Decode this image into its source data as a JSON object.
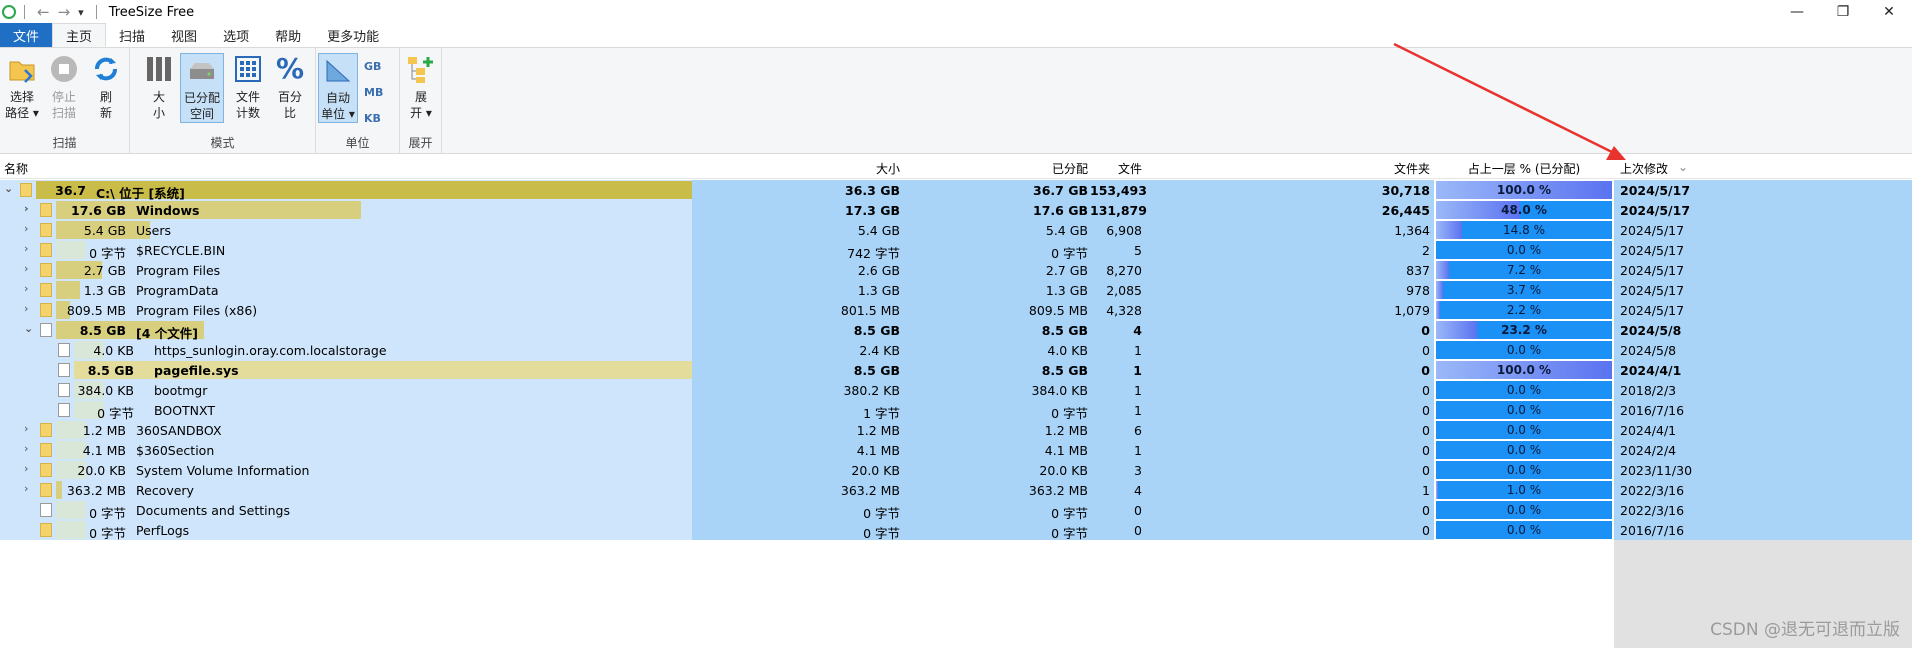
{
  "window": {
    "title": "TreeSize Free",
    "minimize": "—",
    "restore": "❐",
    "close": "✕",
    "back": "←",
    "forward": "→",
    "quick_access": "▾"
  },
  "tabs": [
    "文件",
    "主页",
    "扫描",
    "视图",
    "选项",
    "帮助",
    "更多功能"
  ],
  "ribbon": {
    "groups": {
      "scan": "扫描",
      "mode": "模式",
      "unit": "单位",
      "expand": "展开"
    },
    "buttons": {
      "select_path": "选择路径",
      "select_path_l1": "选择",
      "select_path_l2": "路径 ▾",
      "stop_l1": "停止",
      "stop_l2": "扫描",
      "refresh_l1": "刷",
      "refresh_l2": "新",
      "size_l1": "大",
      "size_l2": "小",
      "alloc_l1": "已分配",
      "alloc_l2": "空间",
      "count_l1": "文件",
      "count_l2": "计数",
      "pct_l1": "百分",
      "pct_l2": "比",
      "auto_l1": "自动",
      "auto_l2": "单位 ▾",
      "gb": "GB",
      "mb": "MB",
      "kb": "KB",
      "expand_l1": "展",
      "expand_l2": "开 ▾"
    }
  },
  "columns": {
    "name": "名称",
    "size": "大小",
    "allocated": "已分配",
    "files": "文件",
    "folders": "文件夹",
    "parent_pct": "占上一层 % (已分配)",
    "modified": "上次修改",
    "sort_indicator": "⌄"
  },
  "rows": [
    {
      "name": "C:\\  位于 [系统]",
      "size_label": "36.7 GB",
      "size": "36.3 GB",
      "allocated": "36.7 GB",
      "files": "153,493",
      "folders": "30,718",
      "pct": "100.0 %",
      "pct_value": 1.0,
      "bar_fraction": 1.0,
      "date": "2024/5/17",
      "bold": true,
      "level": 0,
      "icon": "folder",
      "expander": "⌄"
    },
    {
      "name": "Windows",
      "size_label": "17.6 GB",
      "size": "17.3 GB",
      "allocated": "17.6 GB",
      "files": "131,879",
      "folders": "26,445",
      "pct": "48.0 %",
      "pct_value": 0.48,
      "bar_fraction": 0.48,
      "date": "2024/5/17",
      "bold": true,
      "level": 1,
      "icon": "folder",
      "expander": "›"
    },
    {
      "name": "Users",
      "size_label": "5.4 GB",
      "size": "5.4 GB",
      "allocated": "5.4 GB",
      "files": "6,908",
      "folders": "1,364",
      "pct": "14.8 %",
      "pct_value": 0.148,
      "bar_fraction": 0.148,
      "date": "2024/5/17",
      "bold": false,
      "level": 1,
      "icon": "folder",
      "expander": "›"
    },
    {
      "name": "$RECYCLE.BIN",
      "size_label": "0 字节",
      "size": "742 字节",
      "allocated": "0 字节",
      "files": "5",
      "folders": "2",
      "pct": "0.0 %",
      "pct_value": 0.0,
      "bar_fraction": 0.0,
      "date": "2024/5/17",
      "bold": false,
      "level": 1,
      "icon": "folder",
      "expander": "›"
    },
    {
      "name": "Program Files",
      "size_label": "2.7 GB",
      "size": "2.6 GB",
      "allocated": "2.7 GB",
      "files": "8,270",
      "folders": "837",
      "pct": "7.2 %",
      "pct_value": 0.072,
      "bar_fraction": 0.072,
      "date": "2024/5/17",
      "bold": false,
      "level": 1,
      "icon": "folder",
      "expander": "›"
    },
    {
      "name": "ProgramData",
      "size_label": "1.3 GB",
      "size": "1.3 GB",
      "allocated": "1.3 GB",
      "files": "2,085",
      "folders": "978",
      "pct": "3.7 %",
      "pct_value": 0.037,
      "bar_fraction": 0.037,
      "date": "2024/5/17",
      "bold": false,
      "level": 1,
      "icon": "folder",
      "expander": "›"
    },
    {
      "name": "Program Files (x86)",
      "size_label": "809.5 MB",
      "size": "801.5 MB",
      "allocated": "809.5 MB",
      "files": "4,328",
      "folders": "1,079",
      "pct": "2.2 %",
      "pct_value": 0.022,
      "bar_fraction": 0.022,
      "date": "2024/5/17",
      "bold": false,
      "level": 1,
      "icon": "folder",
      "expander": "›"
    },
    {
      "name": "[4 个文件]",
      "size_label": "8.5 GB",
      "size": "8.5 GB",
      "allocated": "8.5 GB",
      "files": "4",
      "folders": "0",
      "pct": "23.2 %",
      "pct_value": 0.232,
      "bar_fraction": 0.232,
      "date": "2024/5/8",
      "bold": true,
      "level": 1,
      "icon": "file",
      "expander": "⌄"
    },
    {
      "name": "https_sunlogin.oray.com.localstorage",
      "size_label": "4.0 KB",
      "size": "2.4 KB",
      "allocated": "4.0 KB",
      "files": "1",
      "folders": "0",
      "pct": "0.0 %",
      "pct_value": 0.0,
      "bar_fraction": 0.0,
      "date": "2024/5/8",
      "bold": false,
      "level": 2,
      "icon": "file",
      "expander": ""
    },
    {
      "name": "pagefile.sys",
      "size_label": "8.5 GB",
      "size": "8.5 GB",
      "allocated": "8.5 GB",
      "files": "1",
      "folders": "0",
      "pct": "100.0 %",
      "pct_value": 1.0,
      "bar_fraction": 1.0,
      "date": "2024/4/1",
      "bold": true,
      "level": 2,
      "icon": "sys",
      "expander": ""
    },
    {
      "name": "bootmgr",
      "size_label": "384.0 KB",
      "size": "380.2 KB",
      "allocated": "384.0 KB",
      "files": "1",
      "folders": "0",
      "pct": "0.0 %",
      "pct_value": 0.0,
      "bar_fraction": 0.0,
      "date": "2018/2/3",
      "bold": false,
      "level": 2,
      "icon": "file",
      "expander": ""
    },
    {
      "name": "BOOTNXT",
      "size_label": "0 字节",
      "size": "1 字节",
      "allocated": "0 字节",
      "files": "1",
      "folders": "0",
      "pct": "0.0 %",
      "pct_value": 0.0,
      "bar_fraction": 0.0,
      "date": "2016/7/16",
      "bold": false,
      "level": 2,
      "icon": "file",
      "expander": ""
    },
    {
      "name": "360SANDBOX",
      "size_label": "1.2 MB",
      "size": "1.2 MB",
      "allocated": "1.2 MB",
      "files": "6",
      "folders": "0",
      "pct": "0.0 %",
      "pct_value": 0.0,
      "bar_fraction": 0.0,
      "date": "2024/4/1",
      "bold": false,
      "level": 1,
      "icon": "folder",
      "expander": "›"
    },
    {
      "name": "$360Section",
      "size_label": "4.1 MB",
      "size": "4.1 MB",
      "allocated": "4.1 MB",
      "files": "1",
      "folders": "0",
      "pct": "0.0 %",
      "pct_value": 0.0,
      "bar_fraction": 0.0,
      "date": "2024/2/4",
      "bold": false,
      "level": 1,
      "icon": "folder",
      "expander": "›"
    },
    {
      "name": "System Volume Information",
      "size_label": "20.0 KB",
      "size": "20.0 KB",
      "allocated": "20.0 KB",
      "files": "3",
      "folders": "0",
      "pct": "0.0 %",
      "pct_value": 0.0,
      "bar_fraction": 0.0,
      "date": "2023/11/30",
      "bold": false,
      "level": 1,
      "icon": "folder",
      "expander": "›"
    },
    {
      "name": "Recovery",
      "size_label": "363.2 MB",
      "size": "363.2 MB",
      "allocated": "363.2 MB",
      "files": "4",
      "folders": "1",
      "pct": "1.0 %",
      "pct_value": 0.01,
      "bar_fraction": 0.01,
      "date": "2022/3/16",
      "bold": false,
      "level": 1,
      "icon": "folder",
      "expander": "›"
    },
    {
      "name": "Documents and Settings",
      "size_label": "0 字节",
      "size": "0 字节",
      "allocated": "0 字节",
      "files": "0",
      "folders": "0",
      "pct": "0.0 %",
      "pct_value": 0.0,
      "bar_fraction": 0.0,
      "date": "2022/3/16",
      "bold": false,
      "level": 1,
      "icon": "link",
      "expander": ""
    },
    {
      "name": "PerfLogs",
      "size_label": "0 字节",
      "size": "0 字节",
      "allocated": "0 字节",
      "files": "0",
      "folders": "0",
      "pct": "0.0 %",
      "pct_value": 0.0,
      "bar_fraction": 0.0,
      "date": "2016/7/16",
      "bold": false,
      "level": 1,
      "icon": "folder",
      "expander": ""
    }
  ],
  "watermark": "CSDN @退无可退而立版",
  "colors": {
    "accent": "#1f6fc5",
    "row_name_bg": "#cfe5fb",
    "row_data_bg": "#a9d4f8",
    "pct_bar_bg": "#1b90f5",
    "annotation_arrow": "#e8332f"
  }
}
